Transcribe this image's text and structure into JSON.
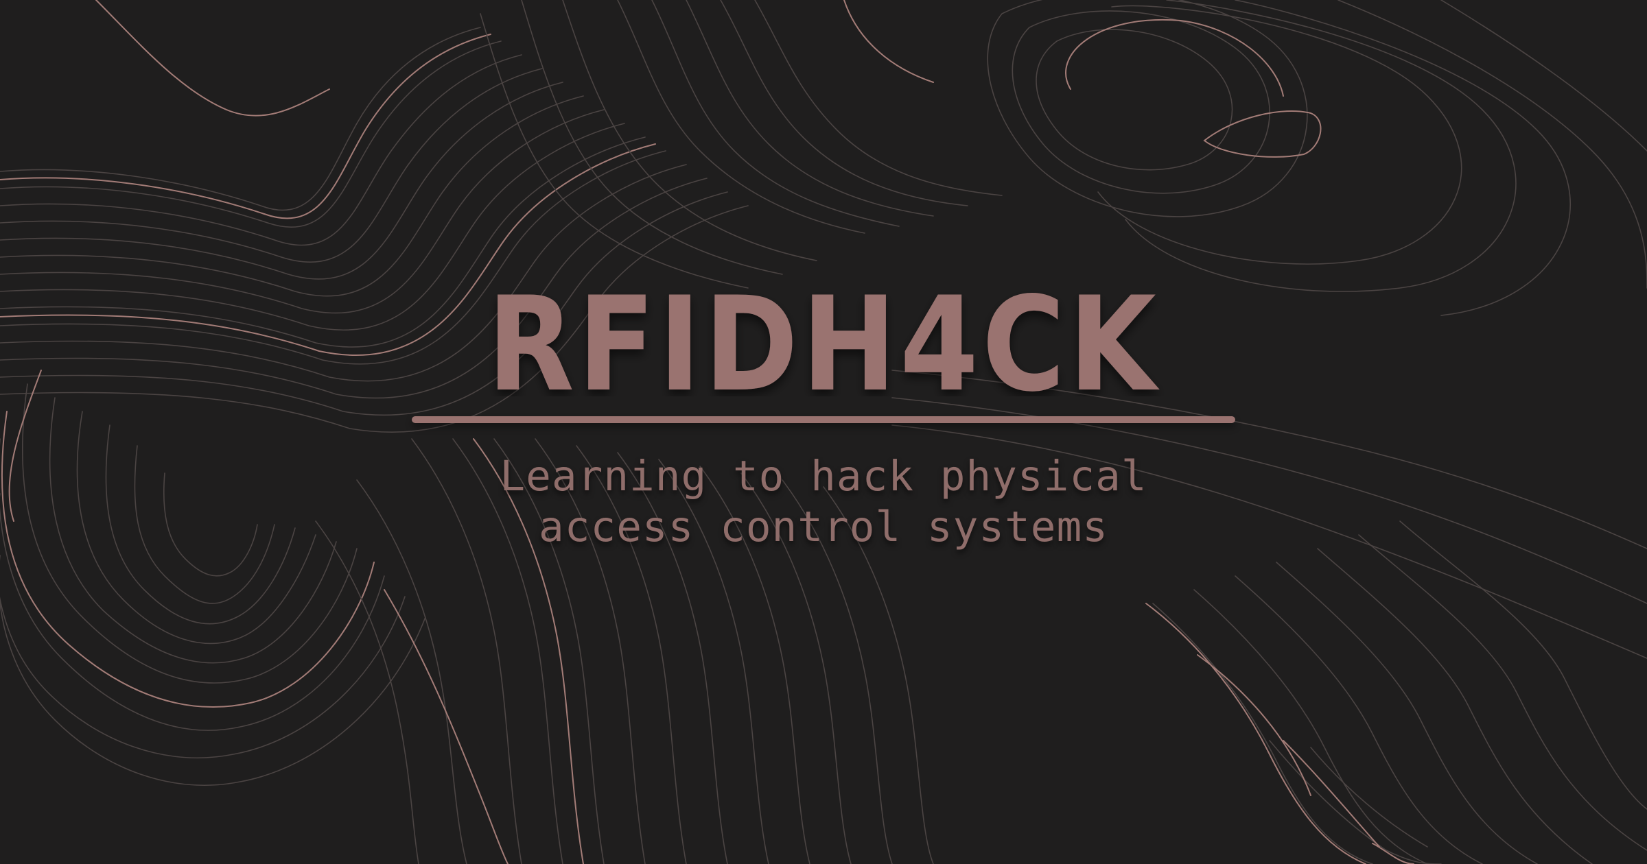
{
  "brand": {
    "logo_text": "RFIDH4CK"
  },
  "tagline": {
    "line1": "Learning to hack physical",
    "line2": "access control systems"
  },
  "colors": {
    "background": "#1f1e1e",
    "accent": "#9a7370",
    "tagline": "#8f6d6a",
    "contour_bright": "#a8807a",
    "contour_dim": "#4a4342"
  }
}
